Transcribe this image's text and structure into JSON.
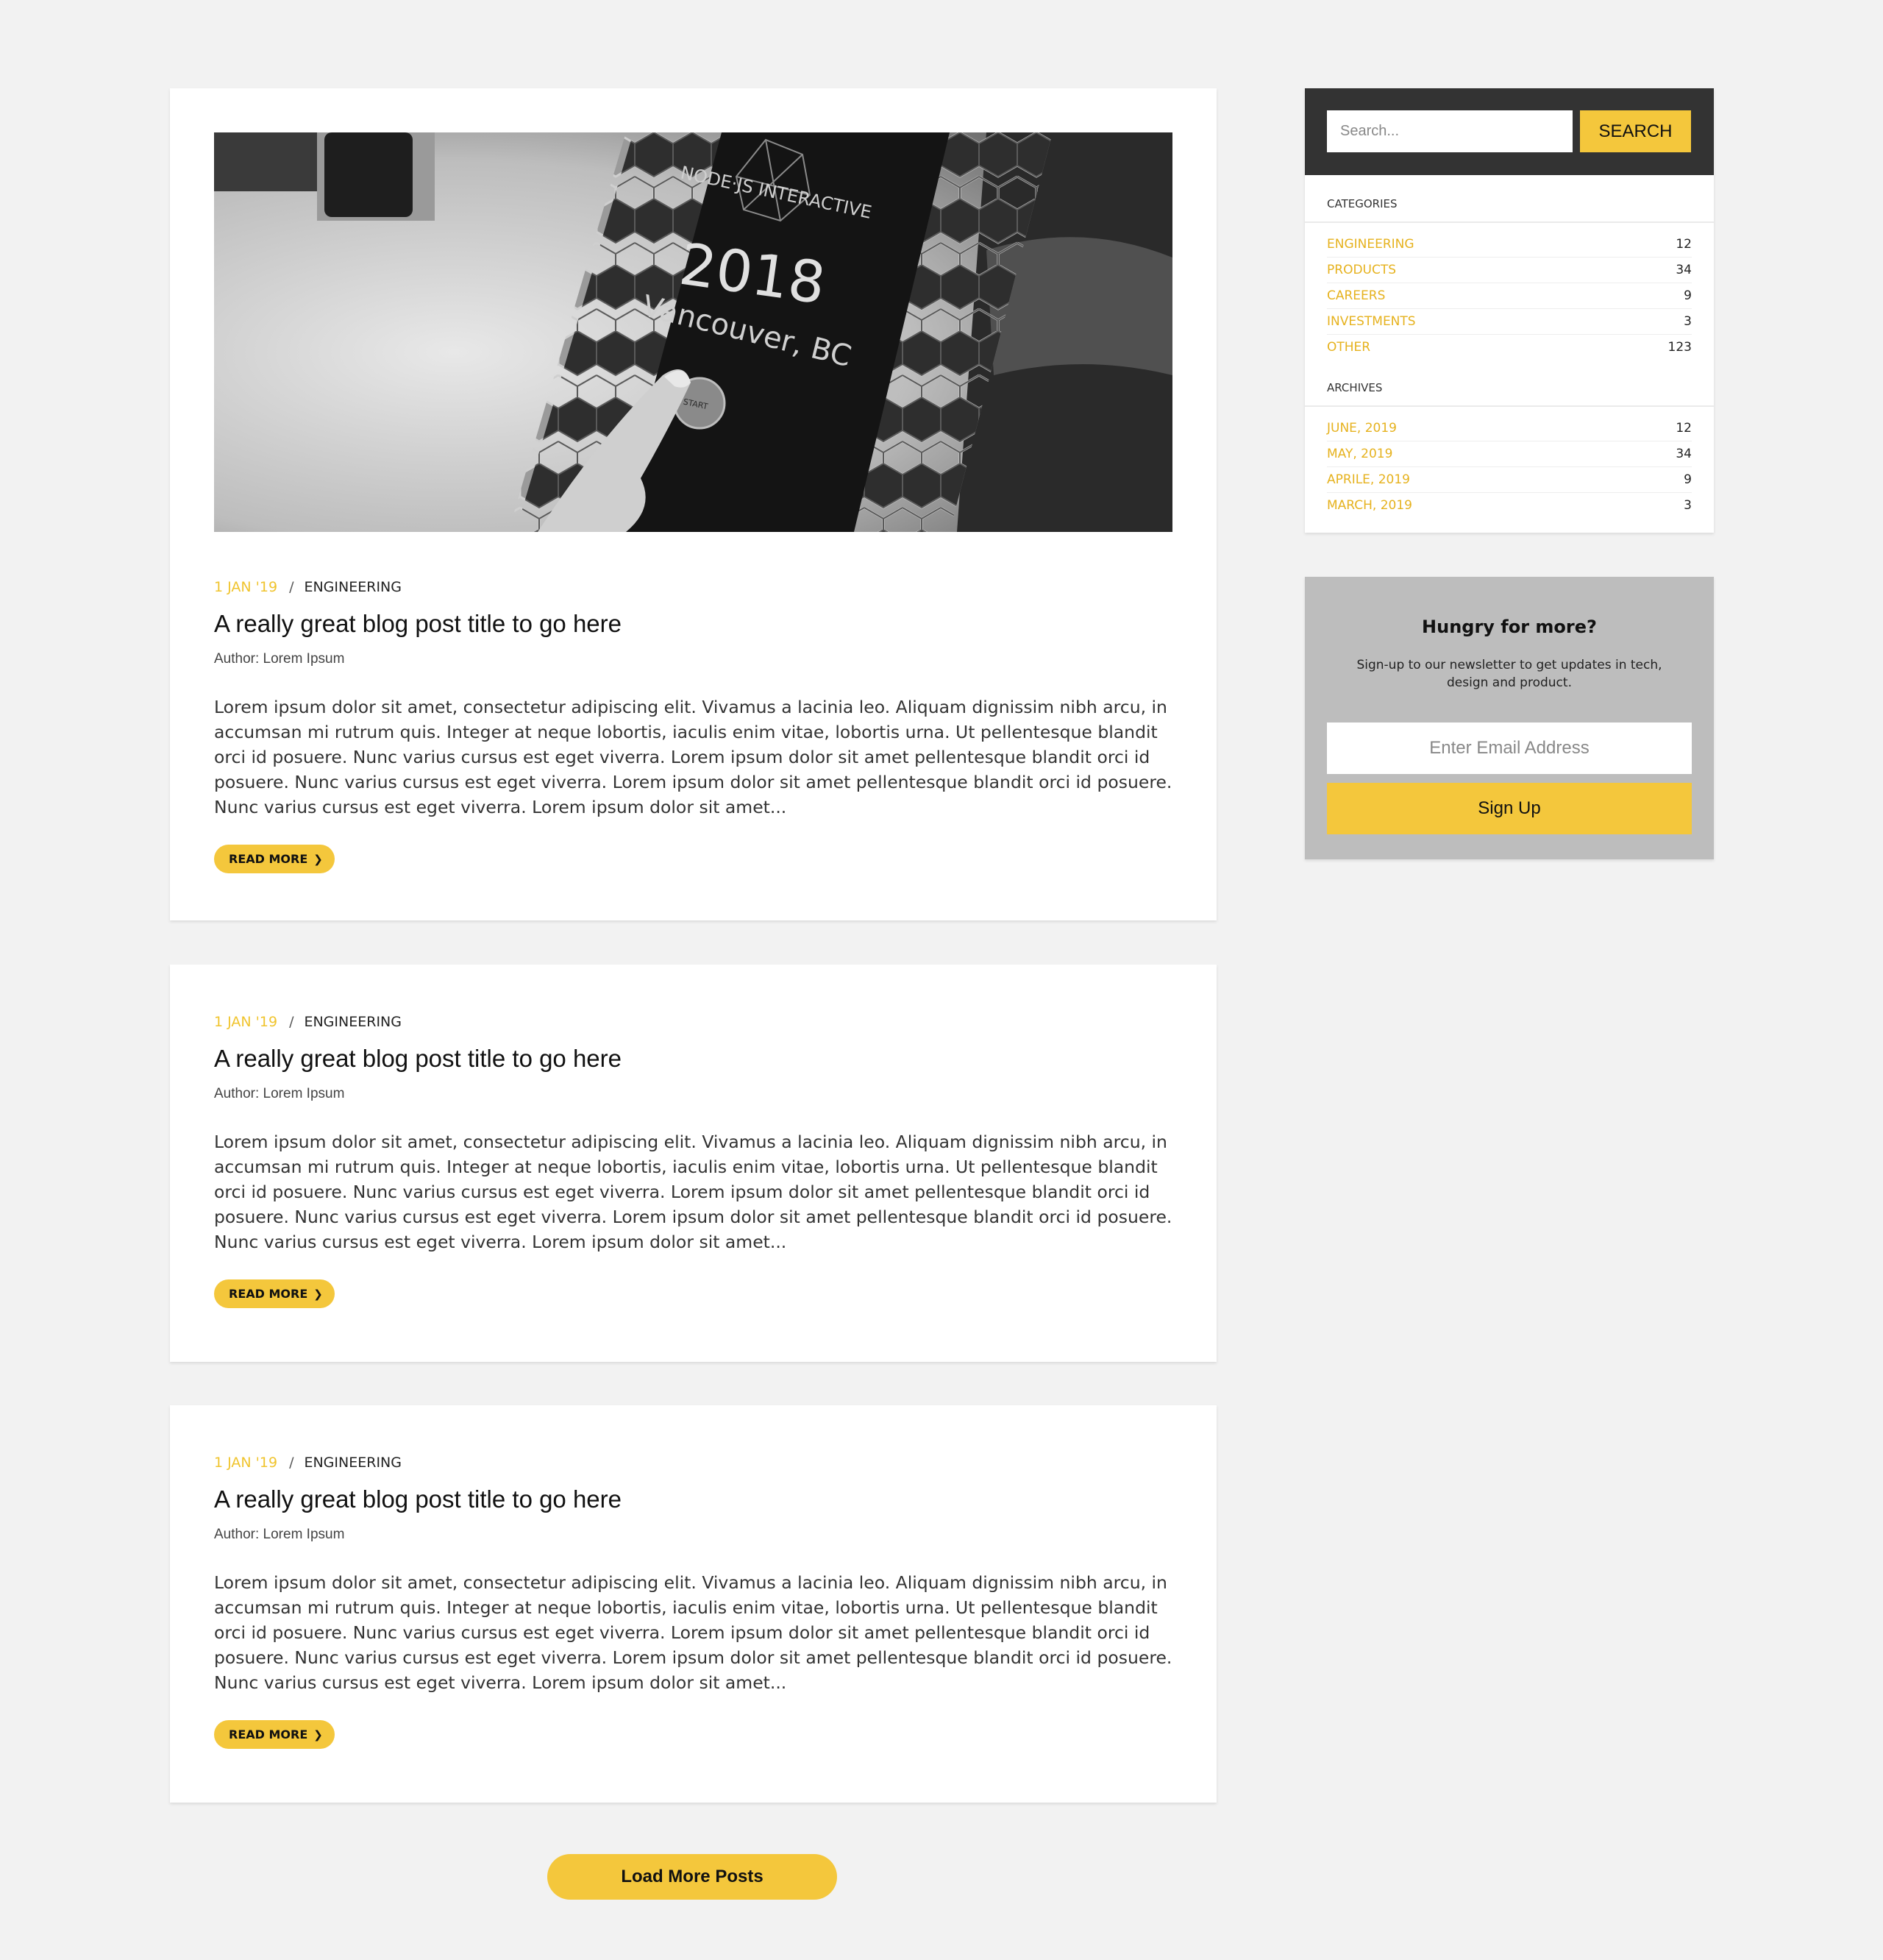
{
  "hero_image": {
    "brand_text": "NODE·JS INTERACTIVE",
    "year_text": "2018",
    "location_text": "Vancouver, BC",
    "button_text": "START"
  },
  "posts": [
    {
      "date": "1 JAN '19",
      "separator": "/",
      "category": "ENGINEERING",
      "title": "A really great blog post title to go here",
      "author": "Author: Lorem Ipsum",
      "excerpt": "Lorem ipsum dolor sit amet, consectetur adipiscing elit. Vivamus a lacinia leo. Aliquam dignissim nibh arcu, in accumsan mi rutrum quis. Integer at neque lobortis, iaculis enim vitae, lobortis urna. Ut pellentesque blandit orci id posuere. Nunc varius cursus est eget viverra. Lorem ipsum dolor sit amet pellentesque blandit orci id posuere. Nunc varius cursus est eget viverra. Lorem ipsum dolor sit amet pellentesque blandit orci id posuere. Nunc varius cursus est eget viverra. Lorem ipsum dolor sit amet...",
      "read_more": "READ MORE"
    },
    {
      "date": "1 JAN '19",
      "separator": "/",
      "category": "ENGINEERING",
      "title": "A really great blog post title to go here",
      "author": "Author: Lorem Ipsum",
      "excerpt": "Lorem ipsum dolor sit amet, consectetur adipiscing elit. Vivamus a lacinia leo. Aliquam dignissim nibh arcu, in accumsan mi rutrum quis. Integer at neque lobortis, iaculis enim vitae, lobortis urna. Ut pellentesque blandit orci id posuere. Nunc varius cursus est eget viverra. Lorem ipsum dolor sit amet pellentesque blandit orci id posuere. Nunc varius cursus est eget viverra. Lorem ipsum dolor sit amet pellentesque blandit orci id posuere. Nunc varius cursus est eget viverra. Lorem ipsum dolor sit amet...",
      "read_more": "READ MORE"
    },
    {
      "date": "1 JAN '19",
      "separator": "/",
      "category": "ENGINEERING",
      "title": "A really great blog post title to go here",
      "author": "Author: Lorem Ipsum",
      "excerpt": "Lorem ipsum dolor sit amet, consectetur adipiscing elit. Vivamus a lacinia leo. Aliquam dignissim nibh arcu, in accumsan mi rutrum quis. Integer at neque lobortis, iaculis enim vitae, lobortis urna. Ut pellentesque blandit orci id posuere. Nunc varius cursus est eget viverra. Lorem ipsum dolor sit amet pellentesque blandit orci id posuere. Nunc varius cursus est eget viverra. Lorem ipsum dolor sit amet pellentesque blandit orci id posuere. Nunc varius cursus est eget viverra. Lorem ipsum dolor sit amet...",
      "read_more": "READ MORE"
    }
  ],
  "load_more": "Load More Posts",
  "search": {
    "placeholder": "Search...",
    "button": "SEARCH"
  },
  "categories": {
    "heading": "CATEGORIES",
    "items": [
      {
        "label": "ENGINEERING",
        "count": "12"
      },
      {
        "label": "PRODUCTS",
        "count": "34"
      },
      {
        "label": "CAREERS",
        "count": "9"
      },
      {
        "label": "INVESTMENTS",
        "count": "3"
      },
      {
        "label": "OTHER",
        "count": "123"
      }
    ]
  },
  "archives": {
    "heading": "ARCHIVES",
    "items": [
      {
        "label": "JUNE, 2019",
        "count": "12"
      },
      {
        "label": "MAY, 2019",
        "count": "34"
      },
      {
        "label": "APRILE, 2019",
        "count": "9"
      },
      {
        "label": "MARCH, 2019",
        "count": "3"
      }
    ]
  },
  "newsletter": {
    "title": "Hungry for more?",
    "subtitle": "Sign-up to our newsletter to get updates in tech, design and product.",
    "placeholder": "Enter Email Address",
    "button": "Sign Up"
  },
  "colors": {
    "accent": "#f4c73c",
    "link": "#e6b21e",
    "background": "#f2f2f2",
    "search_bar": "#333333",
    "newsletter_bg": "#bdbdbd"
  }
}
